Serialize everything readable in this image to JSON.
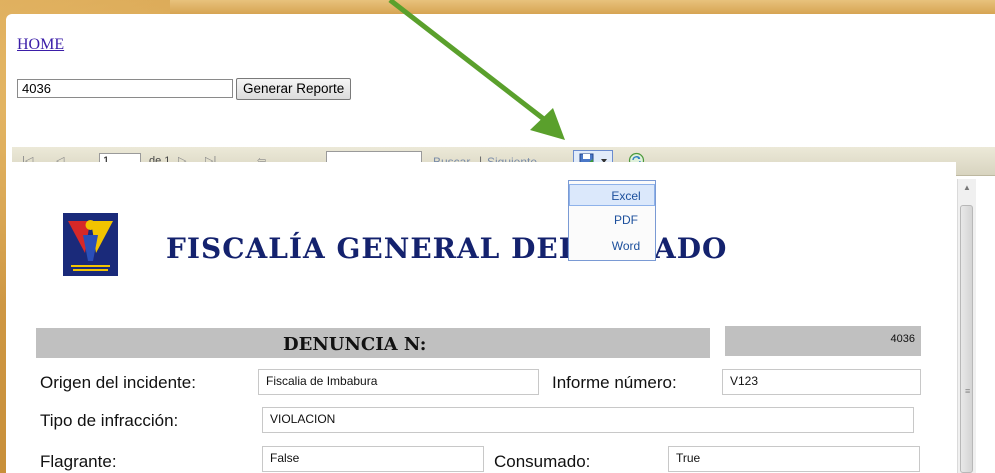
{
  "nav": {
    "home_link": "HOME"
  },
  "search": {
    "value": "4036",
    "button_label": "Generar Reporte"
  },
  "toolbar": {
    "page_value": "1",
    "of_label": "de 1",
    "find_label": "Buscar",
    "separator": "|",
    "next_label": "Siguiente"
  },
  "export_menu": {
    "items": [
      "Excel",
      "PDF",
      "Word"
    ]
  },
  "report": {
    "title": "FISCALÍA GENERAL DEL ESTADO",
    "denuncia_label": "DENUNCIA N:",
    "denuncia_number": "4036",
    "fields": {
      "origen_label": "Origen del incidente:",
      "origen_value": "Fiscalia de Imbabura",
      "informe_label": "Informe número:",
      "informe_value": "V123",
      "tipo_label": "Tipo de infracción:",
      "tipo_value": "VIOLACION",
      "flagrante_label": "Flagrante:",
      "flagrante_value": "False",
      "consumado_label": "Consumado:",
      "consumado_value": "True"
    }
  },
  "colors": {
    "background": "#c8923a",
    "title": "#14226e",
    "link": "#3b1ea8",
    "arrow": "#5aa02c",
    "header_bar": "#c0c0c0"
  }
}
